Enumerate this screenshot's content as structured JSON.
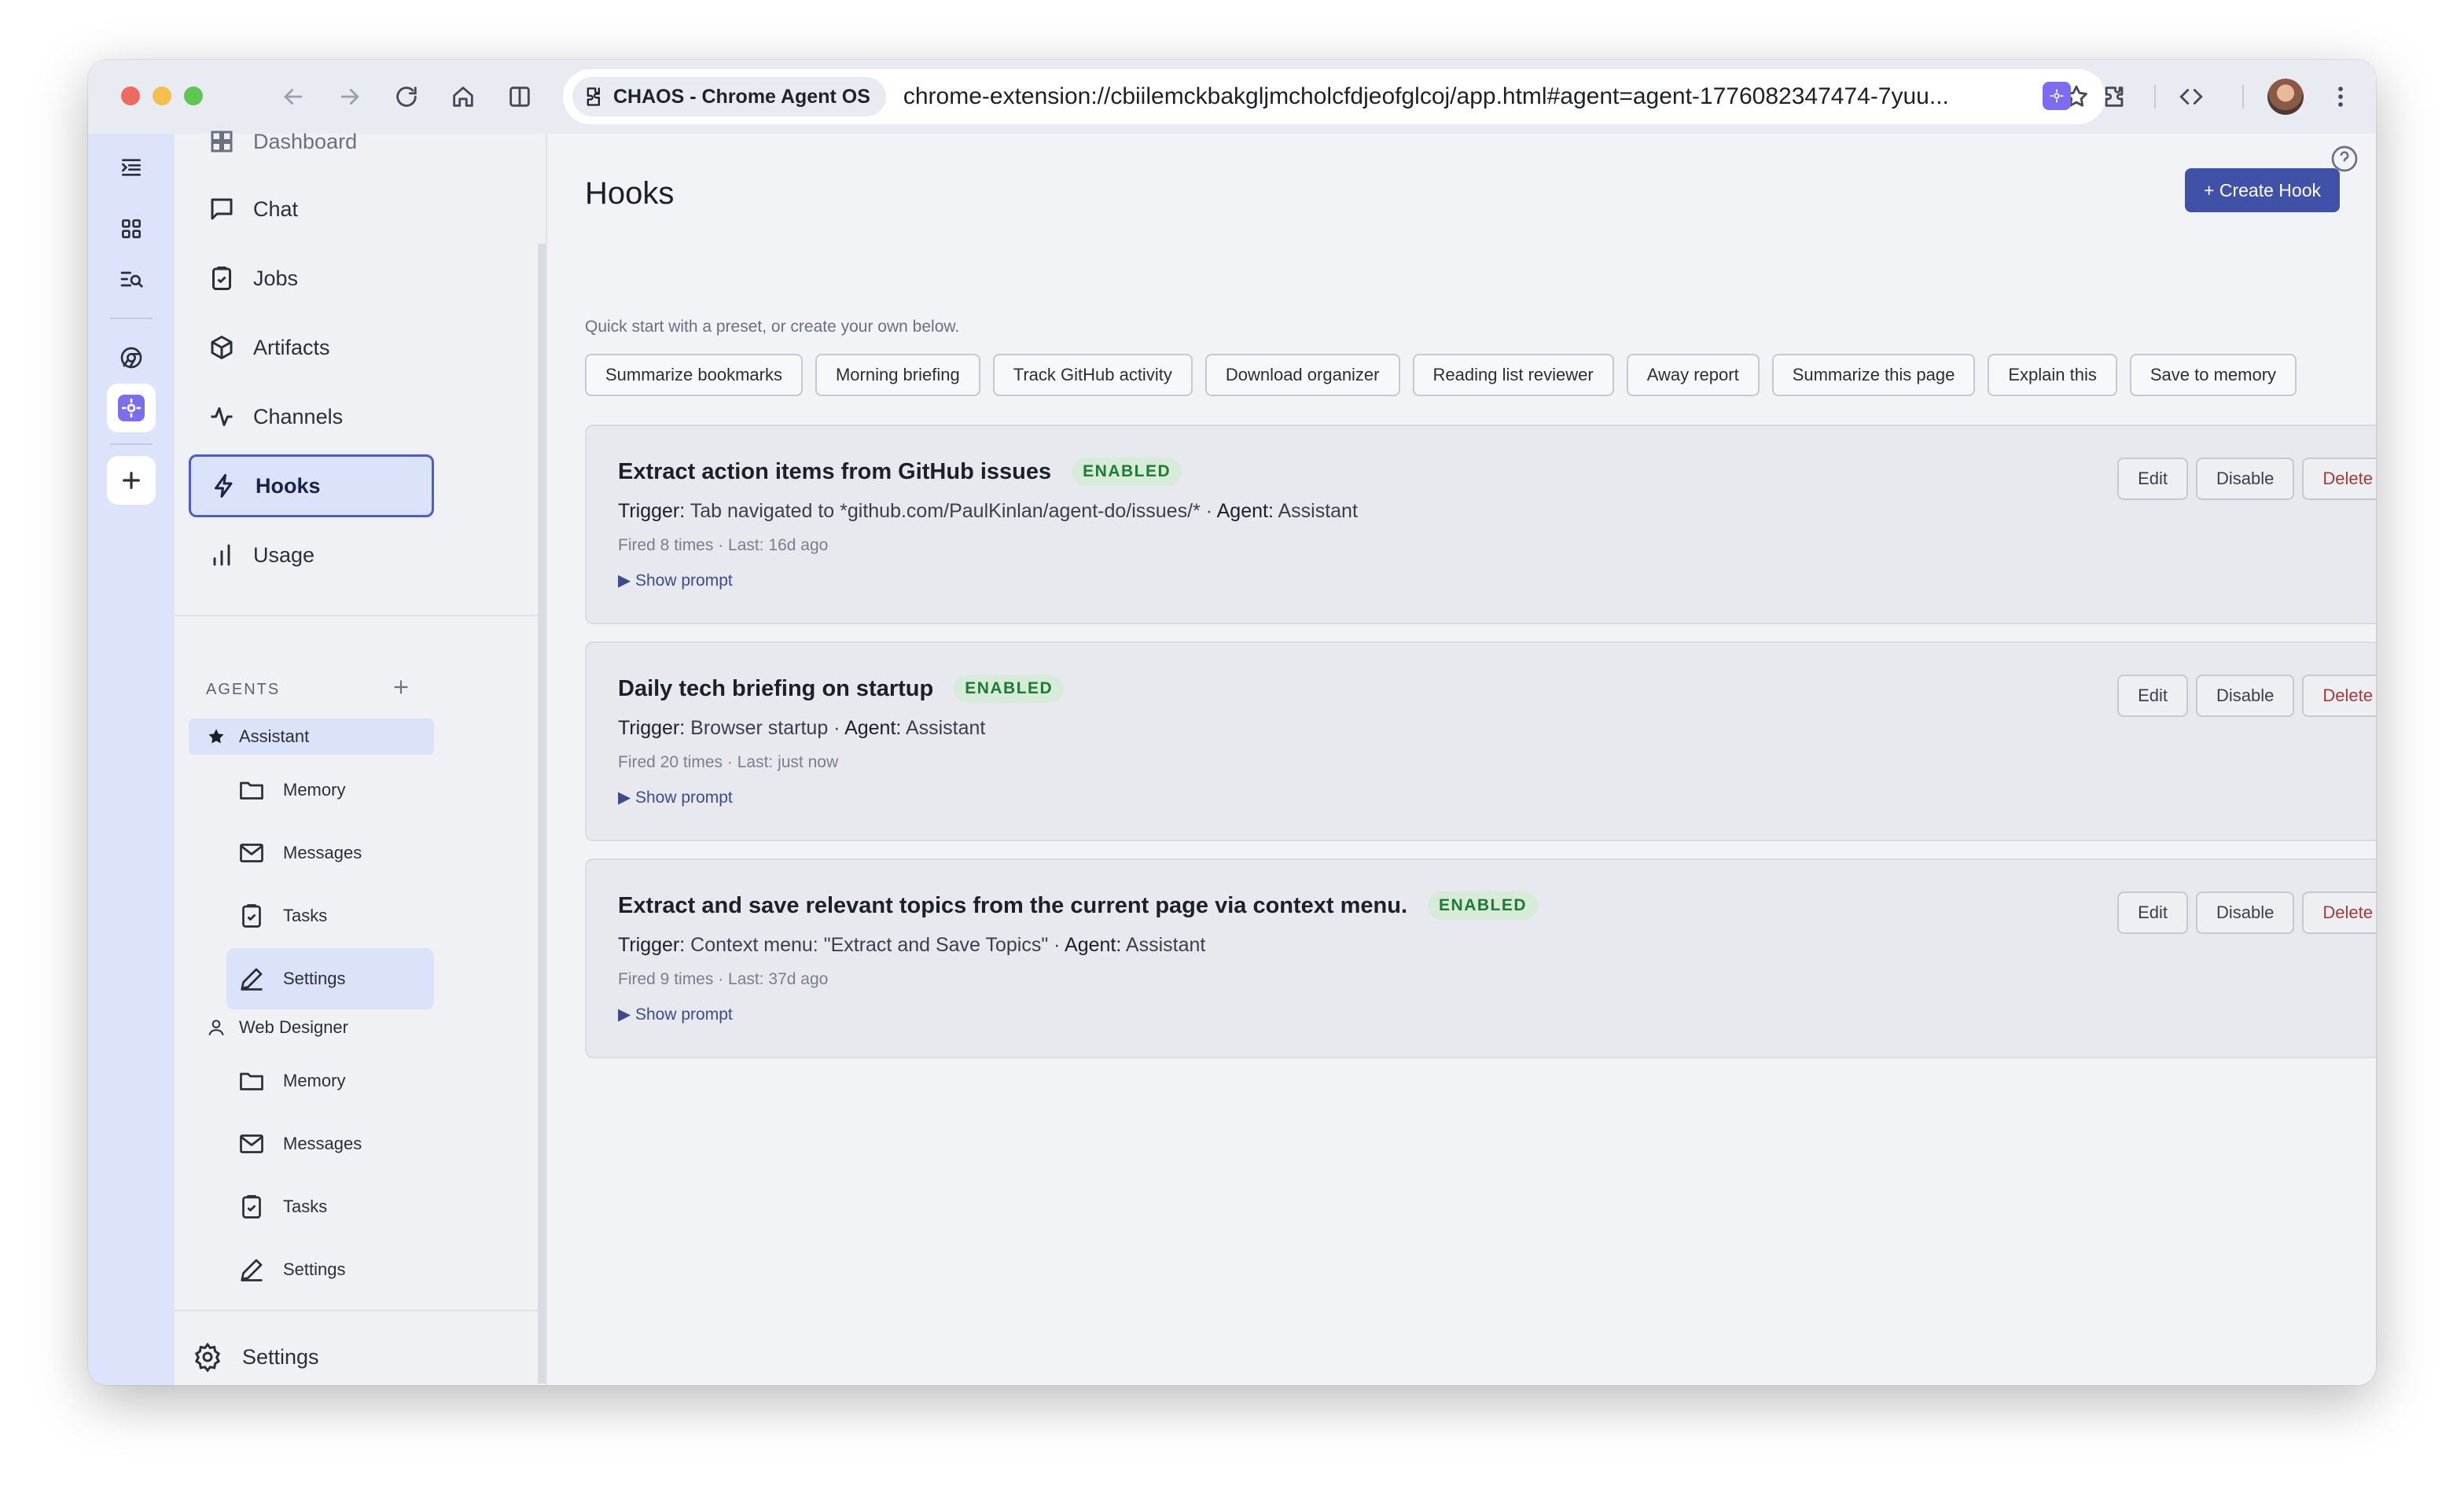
{
  "browser": {
    "tab_chip": "CHAOS - Chrome Agent OS",
    "url": "chrome-extension://cbiilemckbakgljmcholcfdjeofglcoj/app.html#agent=agent-1776082347474-7yuu..."
  },
  "sidebar": {
    "partial_item": "Dashboard",
    "nav": [
      {
        "label": "Chat"
      },
      {
        "label": "Jobs"
      },
      {
        "label": "Artifacts"
      },
      {
        "label": "Channels"
      },
      {
        "label": "Hooks"
      },
      {
        "label": "Usage"
      }
    ],
    "agents_header": "AGENTS",
    "agents": [
      {
        "name": "Assistant",
        "items": [
          "Memory",
          "Messages",
          "Tasks",
          "Settings"
        ]
      },
      {
        "name": "Web Designer",
        "items": [
          "Memory",
          "Messages",
          "Tasks",
          "Settings"
        ]
      }
    ],
    "settings_label": "Settings"
  },
  "main": {
    "title": "Hooks",
    "create_button": "+ Create Hook",
    "hint": "Quick start with a preset, or create your own below.",
    "presets": [
      "Summarize bookmarks",
      "Morning briefing",
      "Track GitHub activity",
      "Download organizer",
      "Reading list reviewer",
      "Away report",
      "Summarize this page",
      "Explain this",
      "Save to memory"
    ],
    "hooks": [
      {
        "title": "Extract action items from GitHub issues",
        "status": "ENABLED",
        "trigger_label": "Trigger:",
        "trigger": "Tab navigated to *github.com/PaulKinlan/agent-do/issues/*",
        "agent_label": "Agent:",
        "agent": "Assistant",
        "stats": "Fired 8 times · Last: 16d ago",
        "prompt_toggle": "▶ Show prompt",
        "edit": "Edit",
        "disable": "Disable",
        "delete": "Delete"
      },
      {
        "title": "Daily tech briefing on startup",
        "status": "ENABLED",
        "trigger_label": "Trigger:",
        "trigger": "Browser startup",
        "agent_label": "Agent:",
        "agent": "Assistant",
        "stats": "Fired 20 times · Last: just now",
        "prompt_toggle": "▶ Show prompt",
        "edit": "Edit",
        "disable": "Disable",
        "delete": "Delete"
      },
      {
        "title": "Extract and save relevant topics from the current page via context menu.",
        "status": "ENABLED",
        "trigger_label": "Trigger:",
        "trigger": "Context menu: \"Extract and Save Topics\"",
        "agent_label": "Agent:",
        "agent": "Assistant",
        "stats": "Fired 9 times · Last: 37d ago",
        "prompt_toggle": "▶ Show prompt",
        "edit": "Edit",
        "disable": "Disable",
        "delete": "Delete"
      }
    ]
  },
  "colors": {
    "accent": "#3f52a8",
    "active_nav_border": "#4c5ec9",
    "enabled_badge_bg": "#d6ecd9",
    "enabled_badge_text": "#1f7a35",
    "delete_text": "#a33a3a"
  }
}
